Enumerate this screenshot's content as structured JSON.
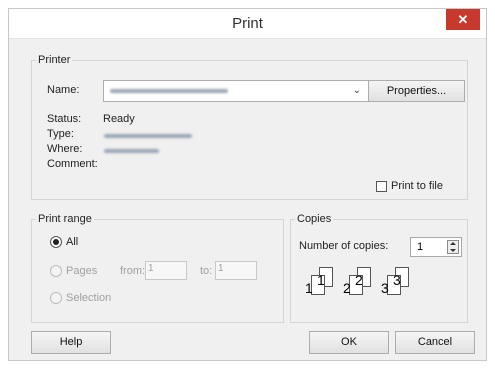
{
  "window": {
    "title": "Print",
    "close_glyph": "✕"
  },
  "printer": {
    "group_label": "Printer",
    "name_label": "Name:",
    "status_label": "Status:",
    "status_value": "Ready",
    "type_label": "Type:",
    "where_label": "Where:",
    "comment_label": "Comment:",
    "properties_label": "Properties...",
    "print_to_file_label": "Print to file",
    "print_to_file_checked": false
  },
  "print_range": {
    "group_label": "Print range",
    "all_label": "All",
    "pages_label": "Pages",
    "from_label": "from:",
    "from_value": "1",
    "to_label": "to:",
    "to_value": "1",
    "selection_label": "Selection",
    "selected": "All"
  },
  "copies": {
    "group_label": "Copies",
    "number_label": "Number of copies:",
    "number_value": "1",
    "collate_icons": [
      "1",
      "1",
      "2",
      "2",
      "3",
      "3"
    ]
  },
  "footer": {
    "help_label": "Help",
    "ok_label": "OK",
    "cancel_label": "Cancel"
  },
  "icons": {
    "dropdown": "chevron-down-icon",
    "spin": "spin-updown-icon"
  }
}
